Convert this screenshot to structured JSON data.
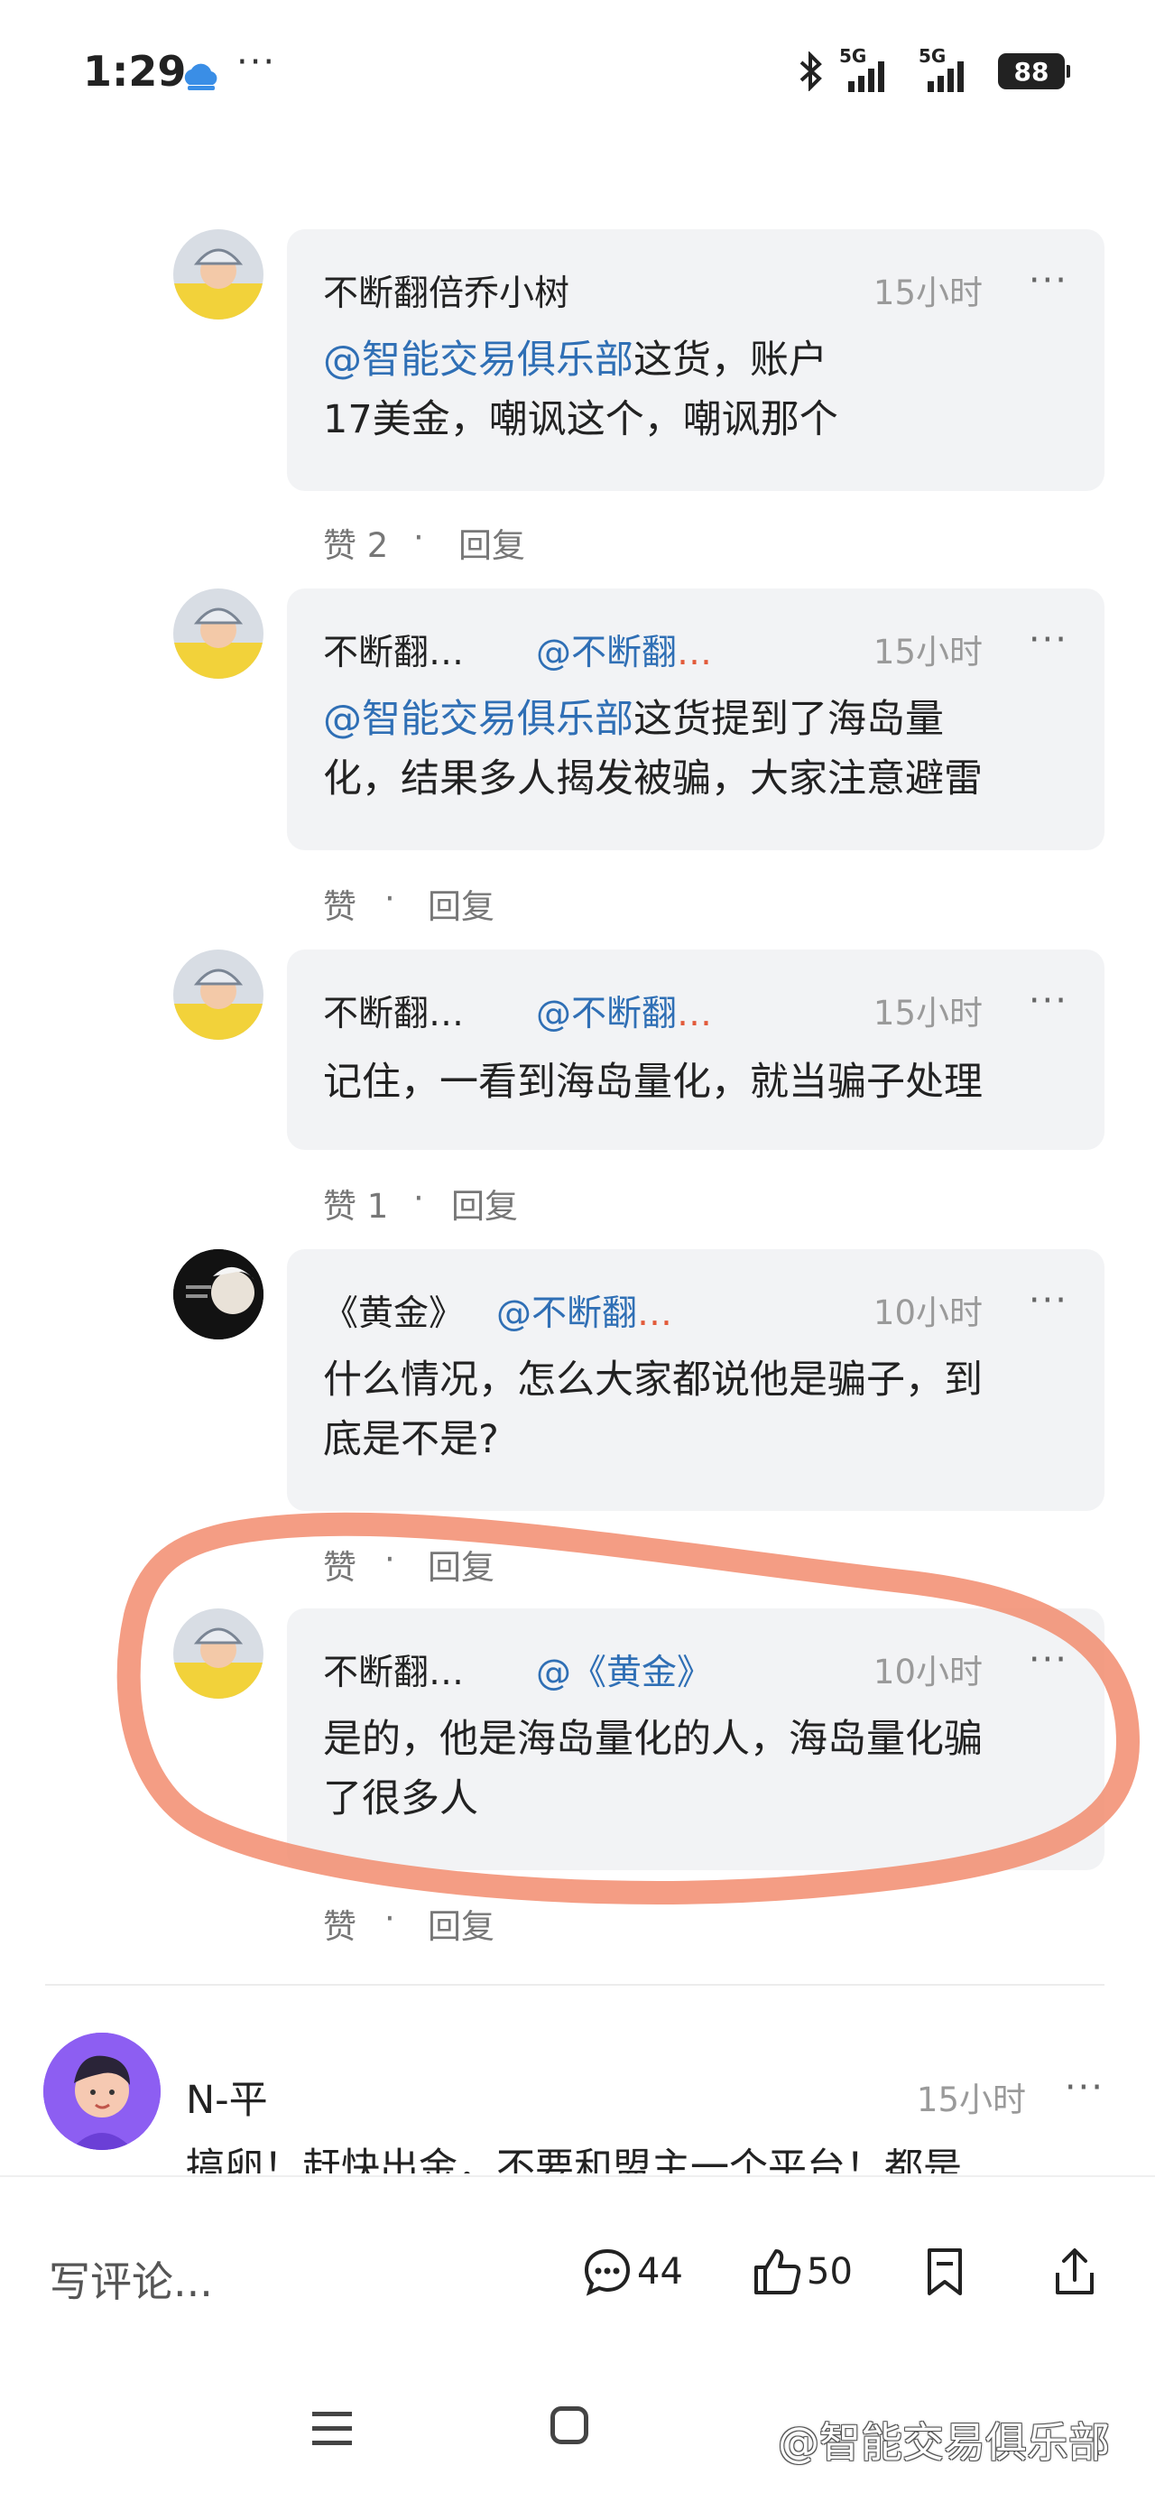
{
  "status_bar": {
    "time": "1:29",
    "net1": "5G",
    "net2": "5G",
    "battery": "88"
  },
  "replies": [
    {
      "name": "不断翻倍乔小树",
      "mention": "",
      "mention_dots": "",
      "time": "15小时",
      "text_at": "@智能交易俱乐部",
      "text_line1_rest": "这货，账户",
      "text_line2": "17美金，嘲讽这个，嘲讽那个",
      "like_label": "赞 2",
      "reply_label": "回复"
    },
    {
      "name": "不断翻…",
      "mention": "@不断翻",
      "mention_dots": "…",
      "time": "15小时",
      "text_at": "@智能交易俱乐部",
      "text_line1_rest": "这货提到了海岛量",
      "text_line2": "化，结果多人揭发被骗，大家注意避雷",
      "like_label": "赞",
      "reply_label": "回复"
    },
    {
      "name": "不断翻…",
      "mention": "@不断翻",
      "mention_dots": "…",
      "time": "15小时",
      "text_at": "",
      "text_line1_rest": "记住，一看到海岛量化，就当骗子处理",
      "text_line2": "",
      "like_label": "赞 1",
      "reply_label": "回复"
    },
    {
      "name": "《黄金》",
      "mention": "@不断翻",
      "mention_dots": "…",
      "time": "10小时",
      "text_at": "",
      "text_line1_rest": "什么情况，怎么大家都说他是骗子，到",
      "text_line2": "底是不是?",
      "like_label": "赞",
      "reply_label": "回复"
    },
    {
      "name": "不断翻…",
      "mention": "@《黄金》",
      "mention_dots": "",
      "time": "10小时",
      "text_at": "",
      "text_line1_rest": "是的，他是海岛量化的人，海岛量化骗",
      "text_line2": "了很多人",
      "like_label": "赞",
      "reply_label": "回复"
    }
  ],
  "comment": {
    "name": "N-平",
    "time": "15小时",
    "text": "搞卵！赶快出金，不要和盟主一个平台！都是"
  },
  "bottom_bar": {
    "input_placeholder": "写评论...",
    "comments_count": "44",
    "likes_count": "50"
  },
  "watermark": "@智能交易俱乐部",
  "colors": {
    "mention": "#2f6fb5",
    "highlight": "#f28c6e",
    "bubble": "#f2f3f5"
  }
}
